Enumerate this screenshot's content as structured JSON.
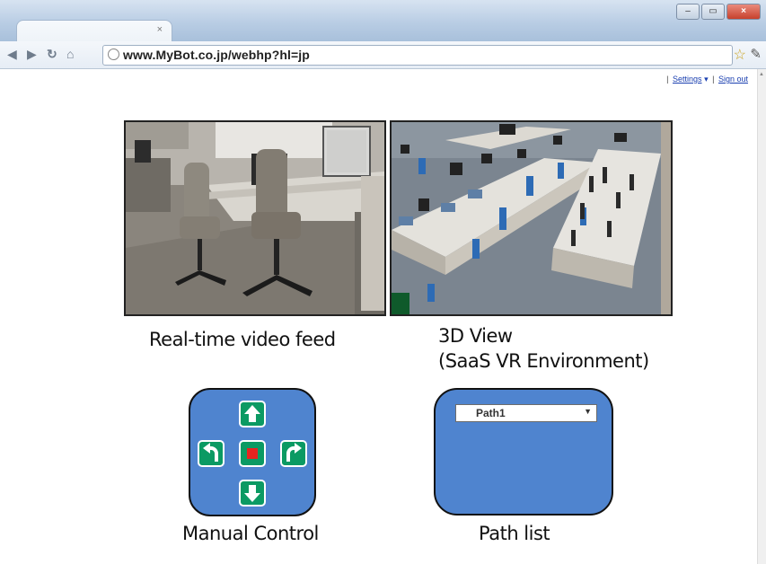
{
  "browser": {
    "url": "www.MyBot.co.jp/webhp?hl=jp",
    "links": {
      "settings": "Settings",
      "settings_arrow": "▾",
      "signout": "Sign out",
      "sep": "|"
    }
  },
  "panels": {
    "video_caption": "Real-time video feed",
    "view3d_caption_line1": "3D View",
    "view3d_caption_line2": "(SaaS VR Environment)"
  },
  "manual_control": {
    "label": "Manual Control"
  },
  "path_list": {
    "label": "Path list",
    "selected": "Path1"
  },
  "colors": {
    "panel_blue": "#4f84cf",
    "control_green": "#0b9a63",
    "stop_red": "#e8231f"
  }
}
